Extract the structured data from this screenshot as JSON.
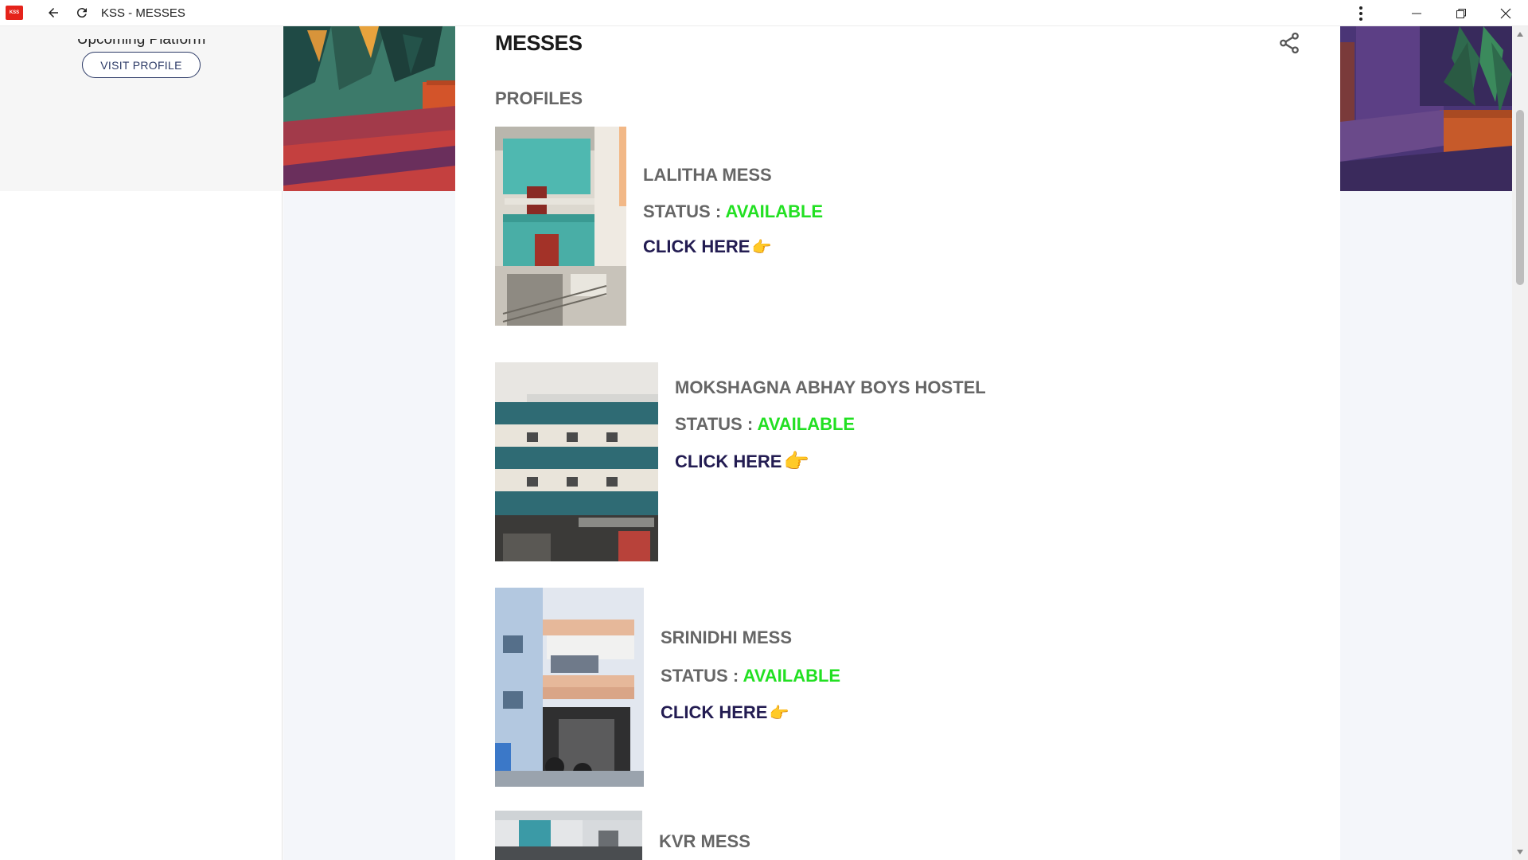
{
  "window": {
    "app_icon_text": "KSS",
    "title": "KSS - MESSES"
  },
  "sidebar": {
    "upcoming_text": "Upcoming Platform",
    "visit_profile_label": "VISIT PROFILE"
  },
  "main": {
    "title": "MESSES",
    "section_label": "PROFILES",
    "status_prefix": "STATUS : ",
    "click_label": "CLICK HERE",
    "hand_emoji": "👉",
    "profiles": [
      {
        "name": "LALITHA MESS",
        "status": "AVAILABLE"
      },
      {
        "name": "MOKSHAGNA ABHAY BOYS HOSTEL",
        "status": "AVAILABLE"
      },
      {
        "name": "SRINIDHI MESS",
        "status": "AVAILABLE"
      },
      {
        "name": "KVR MESS"
      }
    ]
  },
  "colors": {
    "accent_navy": "#231c52",
    "available_green": "#22e022",
    "label_gray": "#666666"
  },
  "icons": [
    "app-icon",
    "back-arrow-icon",
    "reload-icon",
    "more-vert-icon",
    "minimize-icon",
    "restore-icon",
    "close-icon",
    "share-icon",
    "pointing-hand-icon"
  ]
}
